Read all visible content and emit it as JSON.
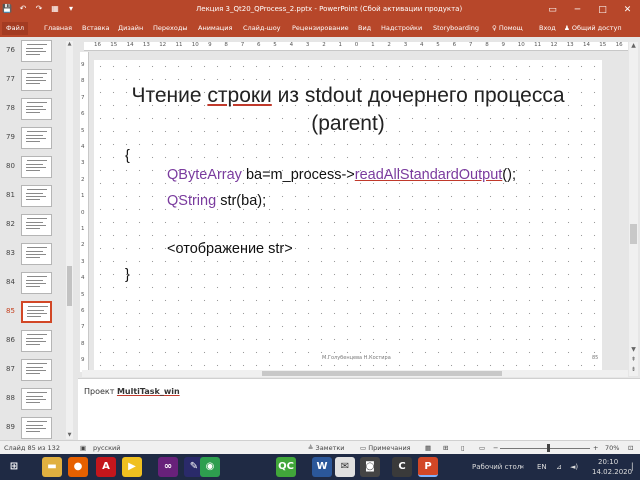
{
  "window": {
    "title": "Лекция 3_Qt20_QProcess_2.pptx - PowerPoint (Сбой активации продукта)",
    "controls": [
      "▭",
      "─",
      "□",
      "✕"
    ]
  },
  "qat": [
    "💾",
    "↶",
    "↷",
    "▦",
    "▾"
  ],
  "ribbon": {
    "file": "Файл",
    "tabs": [
      "Главная",
      "Вставка",
      "Дизайн",
      "Переходы",
      "Анимация",
      "Слайд-шоу",
      "Рецензирование",
      "Вид",
      "Надстройки",
      "Storyboarding"
    ],
    "help": "Помощ",
    "signin": "Вход",
    "share": "Общий доступ"
  },
  "thumbnails": [
    {
      "num": "76",
      "active": false
    },
    {
      "num": "77",
      "active": false
    },
    {
      "num": "78",
      "active": false
    },
    {
      "num": "79",
      "active": false
    },
    {
      "num": "80",
      "active": false
    },
    {
      "num": "81",
      "active": false
    },
    {
      "num": "82",
      "active": false
    },
    {
      "num": "83",
      "active": false
    },
    {
      "num": "84",
      "active": false
    },
    {
      "num": "85",
      "active": true
    },
    {
      "num": "86",
      "active": false
    },
    {
      "num": "87",
      "active": false
    },
    {
      "num": "88",
      "active": false
    },
    {
      "num": "89",
      "active": false
    }
  ],
  "ruler": {
    "h": [
      "16",
      "15",
      "14",
      "13",
      "12",
      "11",
      "10",
      "9",
      "8",
      "7",
      "6",
      "5",
      "4",
      "3",
      "2",
      "1",
      "0",
      "1",
      "2",
      "3",
      "4",
      "5",
      "6",
      "7",
      "8",
      "9",
      "10",
      "11",
      "12",
      "13",
      "14",
      "15",
      "16"
    ],
    "v": [
      "9",
      "8",
      "7",
      "6",
      "5",
      "4",
      "3",
      "2",
      "1",
      "0",
      "1",
      "2",
      "3",
      "4",
      "5",
      "6",
      "7",
      "8",
      "9"
    ]
  },
  "slide": {
    "title_pre": "Чтение ",
    "title_u": "строки",
    "title_post": " из stdout дочернего процесса",
    "title_line2": "(parent)",
    "brace_open": "{",
    "line1_type": "QByteArray",
    "line1_mid": " ba=m_process->",
    "line1_fn": "readAllStandardOutput",
    "line1_end": "();",
    "line2_type": "QString",
    "line2_rest": " str(ba);",
    "line3": "<отображение  str>",
    "brace_close": "}",
    "footer_author": "М.Голубенцева Н.Костира",
    "footer_num": "85"
  },
  "notes": {
    "prefix": "Проект ",
    "project": "MultiTask_win"
  },
  "status": {
    "slide": "Слайд 85 из 132",
    "lang": "русский",
    "notes": "Заметки",
    "comments": "Примечания",
    "zoom_minus": "−",
    "zoom_plus": "+",
    "zoom": "70%"
  },
  "taskbar": {
    "apps": [
      {
        "name": "windows",
        "glyph": "⊞",
        "color": "#1f2a44"
      },
      {
        "name": "explorer",
        "glyph": "▬",
        "color": "#e0b040"
      },
      {
        "name": "firefox",
        "glyph": "●",
        "color": "#e66000"
      },
      {
        "name": "acrobat",
        "glyph": "A",
        "color": "#c4161c"
      },
      {
        "name": "media",
        "glyph": "▶",
        "color": "#f0c020"
      },
      {
        "name": "visual-studio",
        "glyph": "∞",
        "color": "#68217a"
      },
      {
        "name": "pen",
        "glyph": "✎",
        "color": "#2a2a6a"
      },
      {
        "name": "chrome",
        "glyph": "◉",
        "color": "#2e9e4f"
      },
      {
        "name": "qt-creator",
        "glyph": "QC",
        "color": "#41a63a"
      },
      {
        "name": "word",
        "glyph": "W",
        "color": "#2b579a"
      },
      {
        "name": "mail",
        "glyph": "✉",
        "color": "#e0e0e0"
      },
      {
        "name": "camera",
        "glyph": "◙",
        "color": "#444"
      },
      {
        "name": "camtasia",
        "glyph": "C",
        "color": "#3a3a3a"
      },
      {
        "name": "powerpoint",
        "glyph": "P",
        "color": "#d24726"
      }
    ],
    "desktop": "Рабочий стол",
    "lang": "EN",
    "time": "20:10",
    "date": "14.02.2020"
  }
}
